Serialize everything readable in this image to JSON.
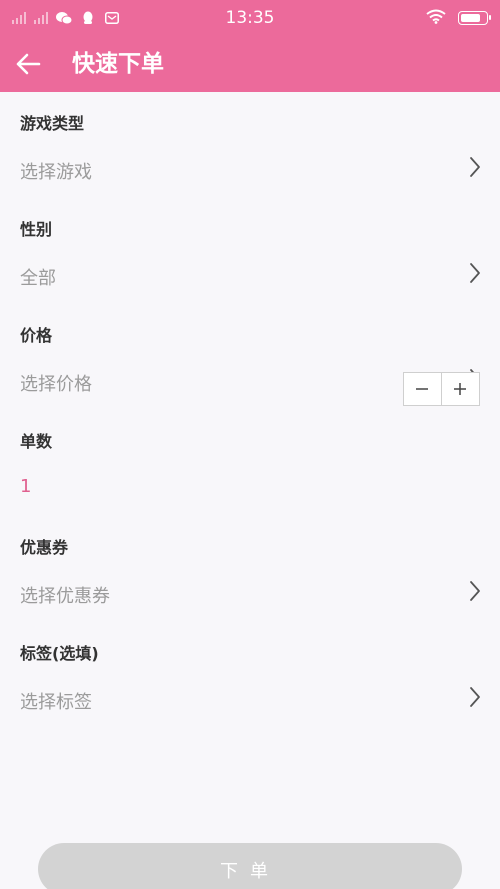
{
  "status_bar": {
    "time": "13:35",
    "icons": [
      "signal-icon",
      "signal-icon",
      "wechat-icon",
      "qq-icon",
      "mail-icon",
      "wifi-icon",
      "battery-icon"
    ]
  },
  "app_bar": {
    "title": "快速下单",
    "back_icon": "arrow-left-icon"
  },
  "form": {
    "game_type": {
      "label": "游戏类型",
      "value": "选择游戏"
    },
    "gender": {
      "label": "性别",
      "value": "全部"
    },
    "price": {
      "label": "价格",
      "value": "选择价格"
    },
    "quantity": {
      "label": "单数",
      "value": "1",
      "minus": "−",
      "plus": "+"
    },
    "coupon": {
      "label": "优惠券",
      "value": "选择优惠券"
    },
    "tags": {
      "label": "标签(选填)",
      "value": "选择标签"
    }
  },
  "submit": {
    "label": "下单"
  },
  "colors": {
    "primary": "#ec6a9b",
    "accent_text": "#e0608f",
    "background": "#f8f7fa",
    "button_disabled": "#d3d3d3"
  }
}
